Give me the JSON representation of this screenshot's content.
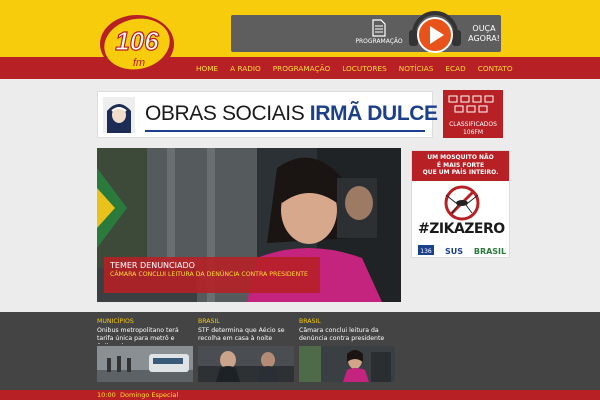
{
  "logo": {
    "number": "106",
    "suffix": "fm"
  },
  "radio": {
    "program_label": "PROGRAMAÇÃO",
    "listen_line1": "OUÇA",
    "listen_line2": "AGORA!"
  },
  "nav": {
    "items": [
      "HOME",
      "A RADIO",
      "PROGRAMAÇÃO",
      "LOCUTORES",
      "NOTÍCIAS",
      "ECAD",
      "CONTATO"
    ]
  },
  "banner": {
    "text_plain": "OBRAS SOCIAIS",
    "text_bold": "IRMÃ DULCE"
  },
  "classifieds": {
    "line1": "CLASSIFICADOS",
    "line2": "106FM"
  },
  "hero": {
    "title": "TEMER DENUNCIADO",
    "subtitle": "CÂMARA CONCLUI LEITURA DA DENÚNCIA CONTRA PRESIDENTE"
  },
  "side_ad": {
    "line1": "UM MOSQUITO NÃO",
    "line2": "É MAIS FORTE",
    "line3": "QUE UM PAÍS INTEIRO.",
    "hashtag": "#ZIKAZERO",
    "logo1": "136",
    "logo2": "SUS",
    "logo3": "BRASIL"
  },
  "news": [
    {
      "category": "MUNICÍPIOS",
      "headline": "Ônibus metropolitano terá tarifa única para metrô e ônibus de"
    },
    {
      "category": "BRASIL",
      "headline": "STF determina que Aécio se recolha em casa à noite"
    },
    {
      "category": "BRASIL",
      "headline": "Câmara conclui leitura da denúncia contra presidente"
    }
  ],
  "footer": {
    "time": "10:00",
    "program": "Domingo Especial"
  },
  "colors": {
    "yellow": "#f7cc0c",
    "red": "#b72024",
    "dark": "#444444",
    "gray": "#5e5e5e"
  }
}
